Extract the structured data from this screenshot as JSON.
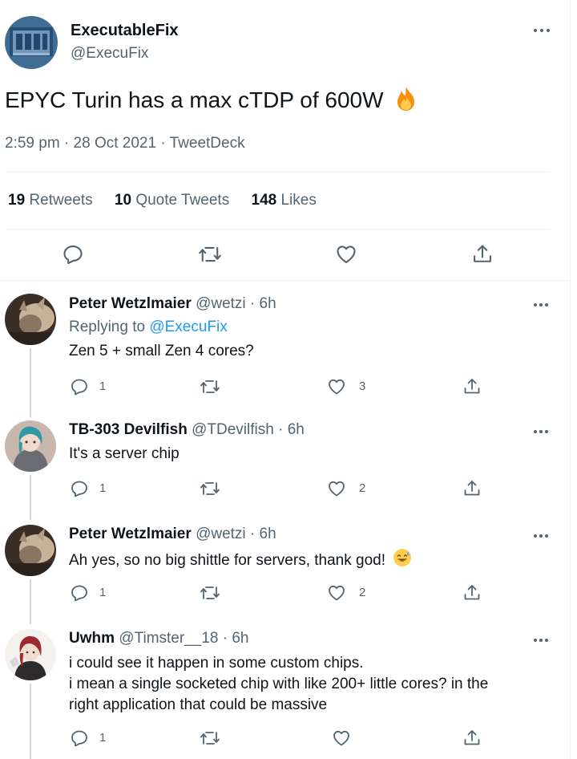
{
  "main_tweet": {
    "author_name": "ExecutableFix",
    "author_handle": "@ExecuFix",
    "text": "EPYC Turin has a max cTDP of 600W",
    "emoji_icon": "fire-emoji",
    "timestamp": "2:59 pm · 28 Oct 2021 · TweetDeck",
    "stats": {
      "retweets_count": "19",
      "retweets_label": "Retweets",
      "quotes_count": "10",
      "quotes_label": "Quote Tweets",
      "likes_count": "148",
      "likes_label": "Likes"
    },
    "actions": [
      "reply-icon",
      "retweet-icon",
      "like-icon",
      "share-icon"
    ]
  },
  "replies": [
    {
      "author_name": "Peter Wetzlmaier",
      "author_handle": "@wetzi",
      "time": "· 6h",
      "replying_prefix": "Replying to",
      "replying_to": "@ExecuFix",
      "text": "Zen 5 + small Zen 4 cores?",
      "reply_count": "1",
      "like_count": "3"
    },
    {
      "author_name": "TB-303 Devilfish",
      "author_handle": "@TDevilfish",
      "time": "· 6h",
      "text": "It's a server chip",
      "reply_count": "1",
      "like_count": "2"
    },
    {
      "author_name": "Peter Wetzlmaier",
      "author_handle": "@wetzi",
      "time": "· 6h",
      "text": "Ah yes, so no big shittle for servers, thank god!",
      "emoji_icon": "sweat-smile-emoji",
      "reply_count": "1",
      "like_count": "2"
    },
    {
      "author_name": "Uwhm",
      "author_handle": "@Timster__18",
      "time": "· 6h",
      "text_line1": "i could see it happen in some custom chips.",
      "text_line2": "i mean a single socketed chip with like 200+ little cores? in the",
      "text_line3": "right application that could be massive",
      "reply_count": "1"
    }
  ],
  "colors": {
    "text": "#0f1419",
    "secondary": "#536471",
    "link": "#1d9bf0",
    "divider": "#eff3f4",
    "thread_line": "#cfd9de"
  }
}
